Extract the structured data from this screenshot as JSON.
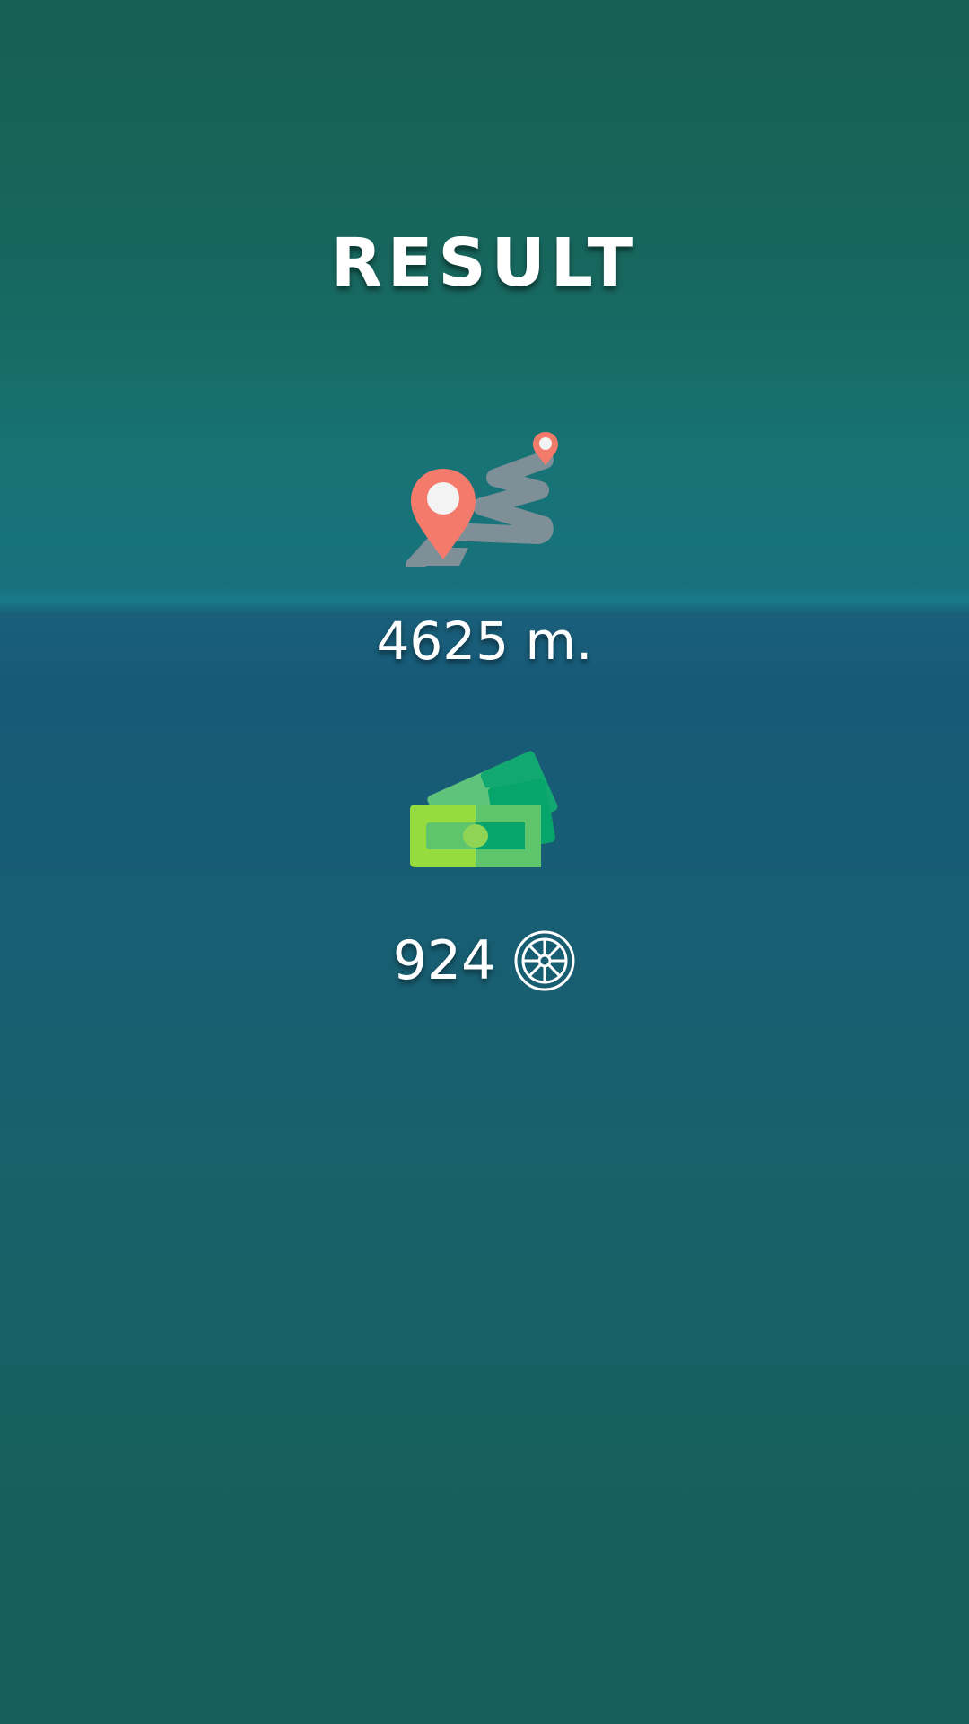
{
  "screen": {
    "title": "RESULT"
  },
  "distance": {
    "value": "4625 m."
  },
  "coins": {
    "value": "924"
  },
  "icons": {
    "distance": "route-map-pin-icon",
    "money": "money-bills-icon",
    "currency": "wheel-coin-icon"
  },
  "colors": {
    "pin": "#f47a6c",
    "road": "#7f8f98",
    "bill_dark": "#06a36a",
    "bill_light": "#8cd84a"
  }
}
